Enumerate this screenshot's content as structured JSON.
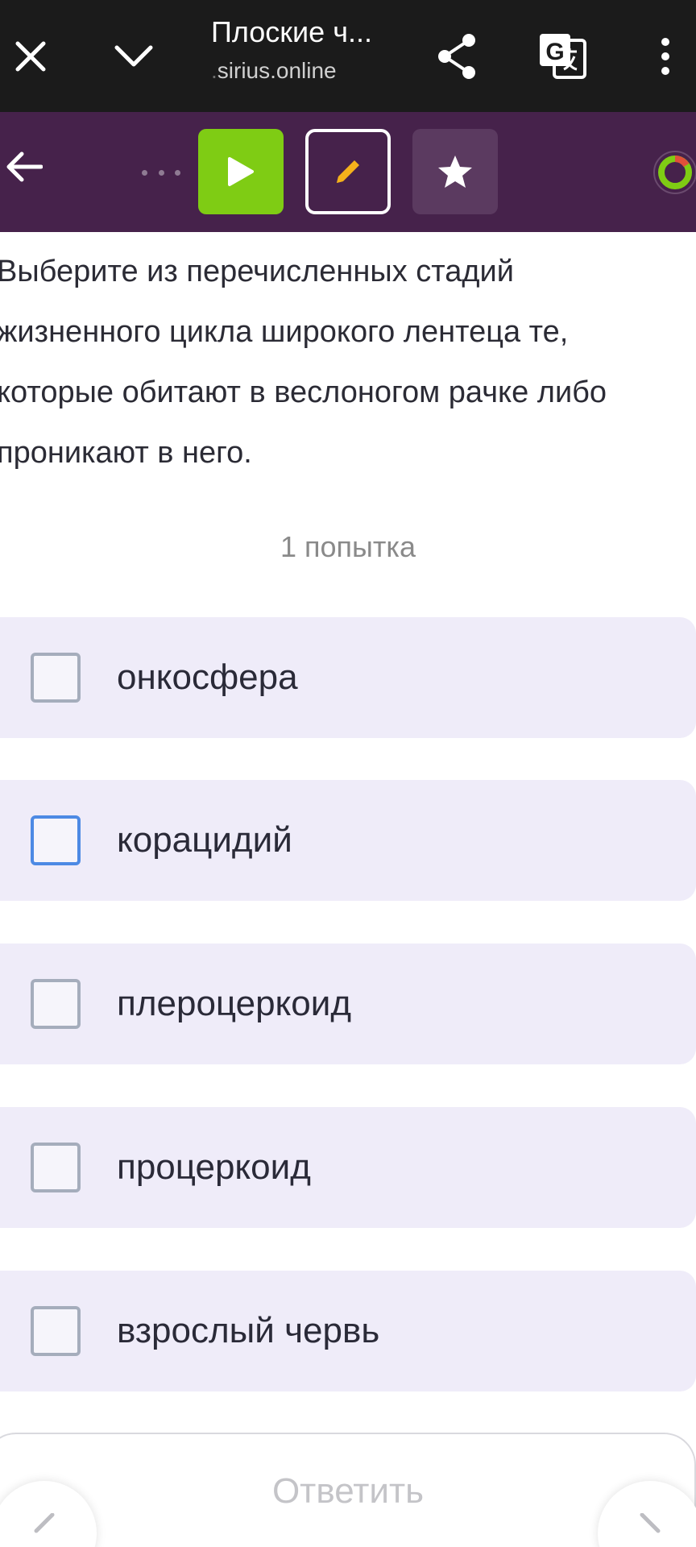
{
  "browser": {
    "title": "Плоские ч...",
    "url_dot": ".",
    "url_domain": "sirius.online",
    "icons": [
      "close-icon",
      "chevron-down-icon",
      "share-icon",
      "translate-icon",
      "more-vert-icon"
    ]
  },
  "toolbar": {
    "icons": [
      "back-arrow-icon",
      "ellipsis-icon",
      "play-icon",
      "pencil-icon",
      "star-icon",
      "progress-ring-icon"
    ],
    "colors": {
      "bar": "#46224b",
      "play": "#7fcc14",
      "pencil": "#f5b21b",
      "progress": "#7fcc14"
    }
  },
  "question": {
    "text": "Выберите из перечисленных стадий жизненного цикла широкого лентеца те, которые обитают в веслоногом рачке либо проникают в него."
  },
  "attempts": "1 попытка",
  "options": [
    {
      "label": "онкосфера",
      "checked": false
    },
    {
      "label": "корацидий",
      "checked": false
    },
    {
      "label": "плероцеркоид",
      "checked": false
    },
    {
      "label": "процеркоид",
      "checked": false
    },
    {
      "label": "взрослый червь",
      "checked": false
    }
  ],
  "answer_button": {
    "label": "Ответить"
  }
}
